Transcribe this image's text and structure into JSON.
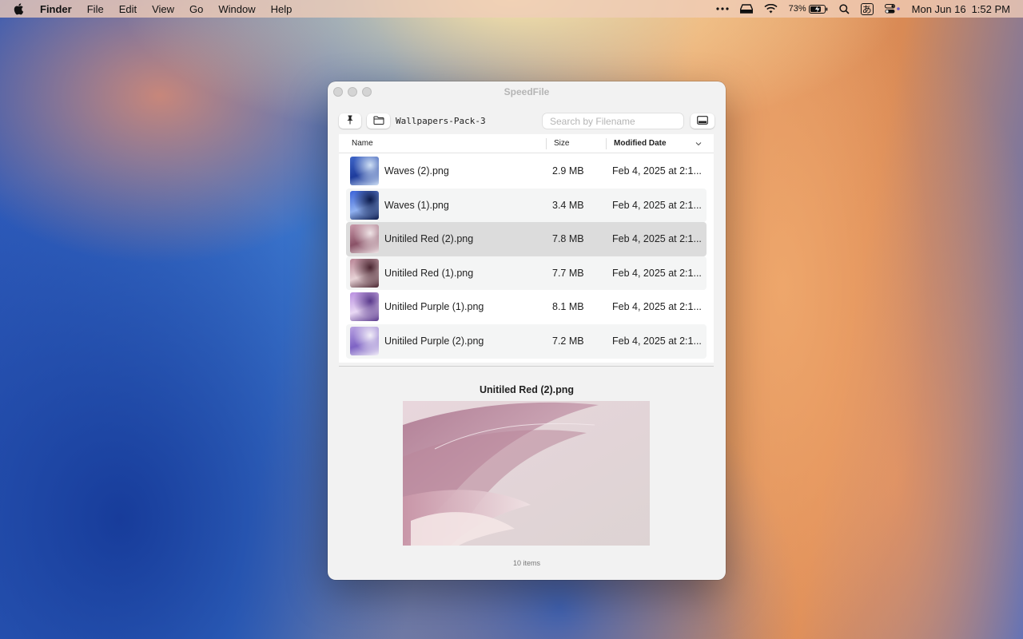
{
  "menubar": {
    "app_name": "Finder",
    "items": [
      "File",
      "Edit",
      "View",
      "Go",
      "Window",
      "Help"
    ],
    "battery": "73%",
    "input_method": "あ",
    "date": "Mon Jun 16",
    "time": "1:52 PM"
  },
  "window": {
    "title": "SpeedFile",
    "path": "Wallpapers-Pack-3",
    "search_placeholder": "Search by Filename"
  },
  "table": {
    "columns": {
      "name": "Name",
      "size": "Size",
      "date": "Modified Date"
    },
    "rows": [
      {
        "name": "Waves (2).png",
        "size": "2.9 MB",
        "date": "Feb 4, 2025 at 2:1...",
        "thumb": "blue-light"
      },
      {
        "name": "Waves (1).png",
        "size": "3.4 MB",
        "date": "Feb 4, 2025 at 2:1...",
        "thumb": "blue-dark"
      },
      {
        "name": "Unitiled Red (2).png",
        "size": "7.8 MB",
        "date": "Feb 4, 2025 at 2:1...",
        "thumb": "red-light"
      },
      {
        "name": "Unitiled Red (1).png",
        "size": "7.7 MB",
        "date": "Feb 4, 2025 at 2:1...",
        "thumb": "red-dark"
      },
      {
        "name": "Unitiled Purple (1).png",
        "size": "8.1 MB",
        "date": "Feb 4, 2025 at 2:1...",
        "thumb": "purple-dark"
      },
      {
        "name": "Unitiled Purple (2).png",
        "size": "7.2 MB",
        "date": "Feb 4, 2025 at 2:1...",
        "thumb": "purple-light"
      }
    ],
    "selected_index": 2
  },
  "preview": {
    "title": "Unitiled Red (2).png"
  },
  "footer": {
    "count": "10 items"
  },
  "thumb_colors": {
    "blue-light": [
      "#cfe0f5",
      "#3f66c8",
      "#1e3c9c"
    ],
    "blue-dark": [
      "#0b1a4a",
      "#3a62d8",
      "#8fb0f0"
    ],
    "red-light": [
      "#efe4e6",
      "#c99aaa",
      "#8a5267"
    ],
    "red-dark": [
      "#4a2530",
      "#b98596",
      "#e7d2d6"
    ],
    "purple-dark": [
      "#5a3a8c",
      "#b98fe0",
      "#e9d8f4"
    ],
    "purple-light": [
      "#f2eef8",
      "#b9a3e2",
      "#7e63c4"
    ]
  }
}
